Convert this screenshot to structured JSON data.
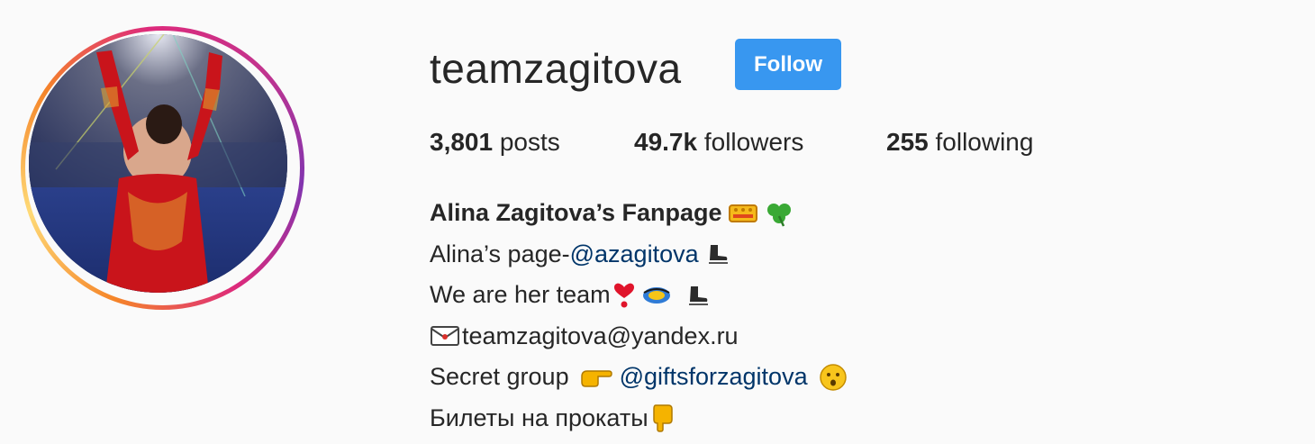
{
  "profile": {
    "username": "teamzagitova",
    "follow_label": "Follow",
    "stats": {
      "posts_count": "3,801",
      "posts_label": " posts",
      "followers_count": "49.7k",
      "followers_label": " followers",
      "following_count": "255",
      "following_label": " following"
    },
    "bio": {
      "name": "Alina Zagitova’s Fanpage",
      "line2_text": "Alina’s page-",
      "line2_mention": "@azagitova",
      "line3_text": "We are her team",
      "line4_text": "teamzagitova@yandex.ru",
      "line5_text": "Secret group",
      "line5_mention": "@giftsforzagitova",
      "line6_text": "Билеты на прокаты"
    }
  },
  "colors": {
    "follow_button": "#3897f0",
    "mention": "#003569",
    "text": "#262626",
    "background": "#fafafa"
  },
  "icons": {
    "name_emojis": [
      "crown-icon",
      "shamrock-icon"
    ],
    "line2_emoji": "ice-skate-icon",
    "line3_emojis": [
      "heavy-heart-exclamation-icon",
      "dizzy-icon",
      "ice-skate-icon"
    ],
    "line4_emoji": "incoming-envelope-icon",
    "line5_emojis": [
      "backhand-index-pointing-right-icon",
      "hushed-face-icon"
    ],
    "line6_emoji": "backhand-index-pointing-down-icon"
  }
}
